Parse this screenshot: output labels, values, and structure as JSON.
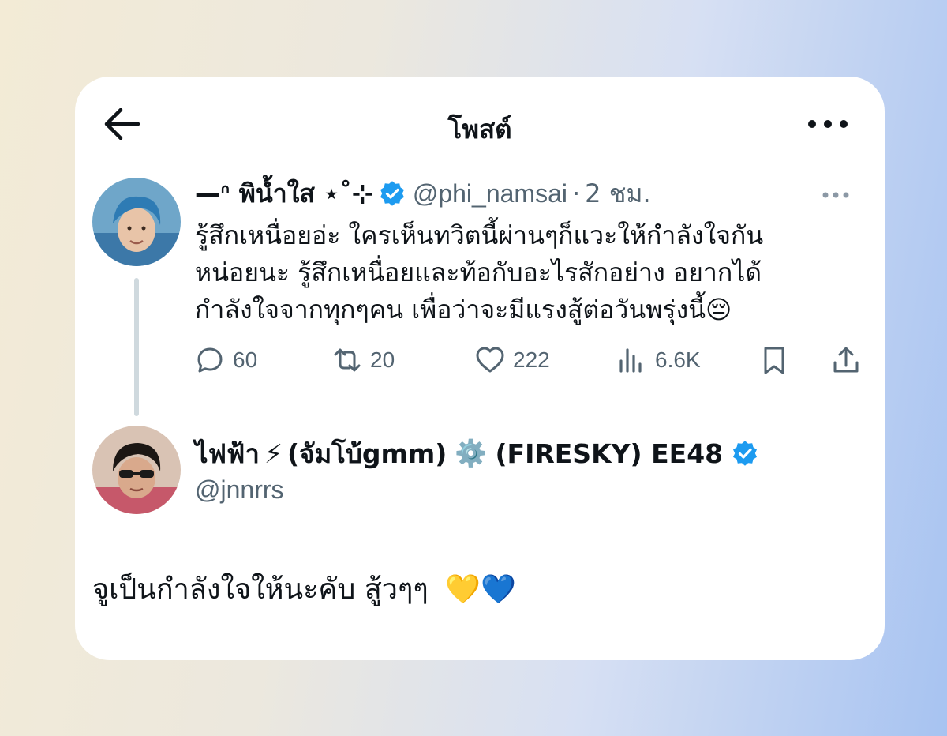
{
  "header": {
    "title": "โพสต์"
  },
  "post": {
    "display_name": "—ᐢ พิน้ำใส ⋆˚⊹",
    "handle": "@phi_namsai",
    "separator": "·",
    "time": "2 ชม.",
    "text_line1": "รู้สึกเหนื่อยอ่ะ ใครเห็นทวิตนี้ผ่านๆก็แวะให้กำลังใจกัน",
    "text_line2": "หน่อยนะ รู้สึกเหนื่อยและท้อกับอะไรสักอย่าง อยากได้",
    "text_line3": "กำลังใจจากทุกๆคน เพื่อว่าจะมีแรงสู้ต่อวันพรุ่งนี้",
    "text_emoji": "😔",
    "replies": "60",
    "reposts": "20",
    "likes": "222",
    "views": "6.6K"
  },
  "reply": {
    "display_name_part1": "ไฟฟ้า",
    "emoji1": "⚡",
    "display_name_part2": "(จัมโบ้gmm)",
    "emoji2": "⚙️",
    "display_name_part3": "(FIRESKY) EE48",
    "handle": "@jnnrrs",
    "text": "จูเป็นกำลังใจให้นะคับ สู้วๆๆ",
    "text_emojis": "💛💙"
  },
  "colors": {
    "accent": "#1d9bf0",
    "secondary_text": "#536471",
    "thread_line": "#cfd9de"
  }
}
